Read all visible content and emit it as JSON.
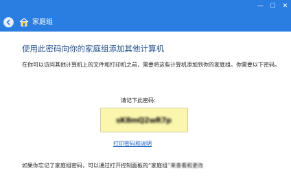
{
  "window": {
    "controls": {
      "minimize": "—",
      "maximize": "☐",
      "close": "✕"
    }
  },
  "nav": {
    "back_icon": "back-arrow-icon",
    "home_icon": "homegroup-icon",
    "title": "家庭组"
  },
  "content": {
    "heading": "使用此密码向你的家庭组添加其他计算机",
    "description": "在你可以访问其他计算机上的文件和打印机之前，需要将这些计算机添加到你的家庭组。你需要以下密码。",
    "password_prompt": "请记下此密码:",
    "password_value": "sK8mQ2wR7p",
    "print_link": "打印密码和说明",
    "bottom_note_prefix": "如果你忘记了家庭组密码，可以通过打开控制面板的“家庭组",
    "bottom_note_suffix": "”来查看和更改"
  },
  "colors": {
    "header_blue": "#2a7de1",
    "heading_blue": "#1f4e8c",
    "password_box": "#fbf6ad",
    "link_blue": "#1d62c7"
  }
}
